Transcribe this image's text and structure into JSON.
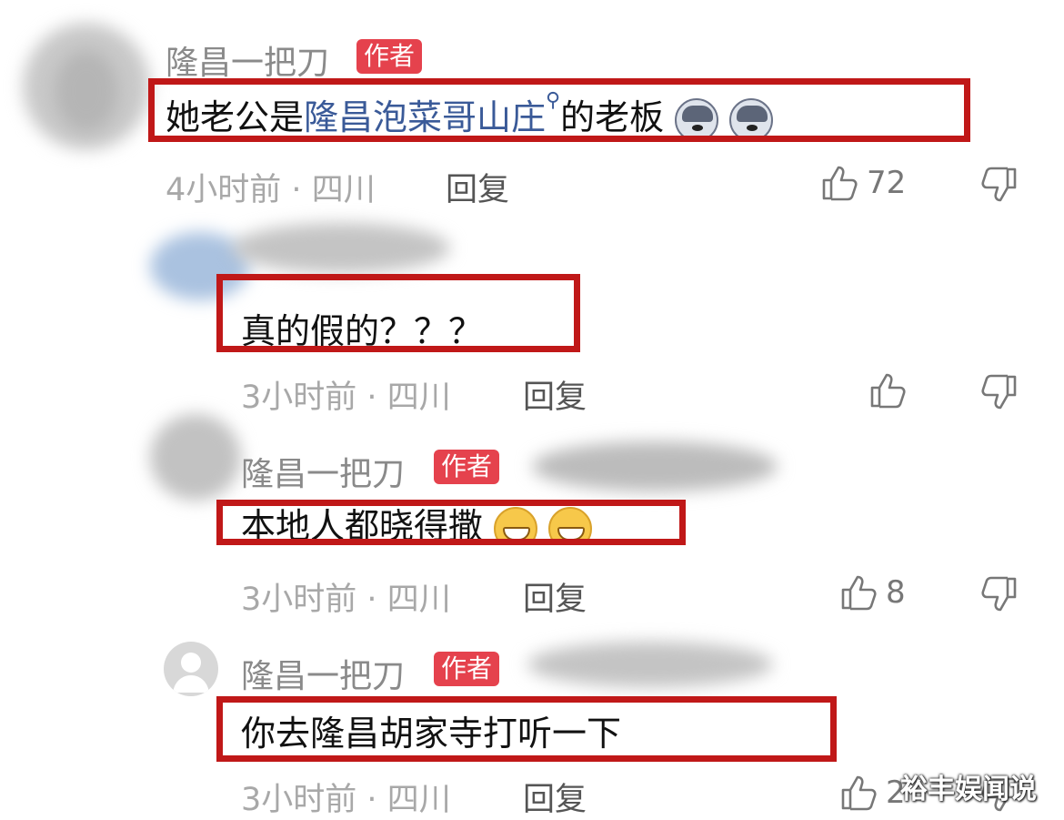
{
  "comments": [
    {
      "author": "隆昌一把刀",
      "author_badge": "作者",
      "text_before": "她老公是",
      "link_text": "隆昌泡菜哥山庄",
      "text_after": "的老板",
      "emojis": [
        "dog-face",
        "dog-face"
      ],
      "time": "4小时前",
      "location": "四川",
      "reply_label": "回复",
      "likes": "72"
    },
    {
      "text": "真的假的？？？",
      "time": "3小时前",
      "location": "四川",
      "reply_label": "回复",
      "likes": ""
    },
    {
      "author": "隆昌一把刀",
      "author_badge": "作者",
      "text": "本地人都晓得撒",
      "emojis": [
        "grin-face",
        "grin-face"
      ],
      "time": "3小时前",
      "location": "四川",
      "reply_label": "回复",
      "likes": "8"
    },
    {
      "author": "隆昌一把刀",
      "author_badge": "作者",
      "text": "你去隆昌胡家寺打听一下",
      "time": "3小时前",
      "location": "四川",
      "reply_label": "回复",
      "likes": "2"
    }
  ],
  "meta_separator": "·",
  "watermark": "裕丰娱闻说",
  "colors": {
    "highlight_box": "#c01818",
    "author_badge": "#e5424d",
    "link": "#3a5a98"
  }
}
